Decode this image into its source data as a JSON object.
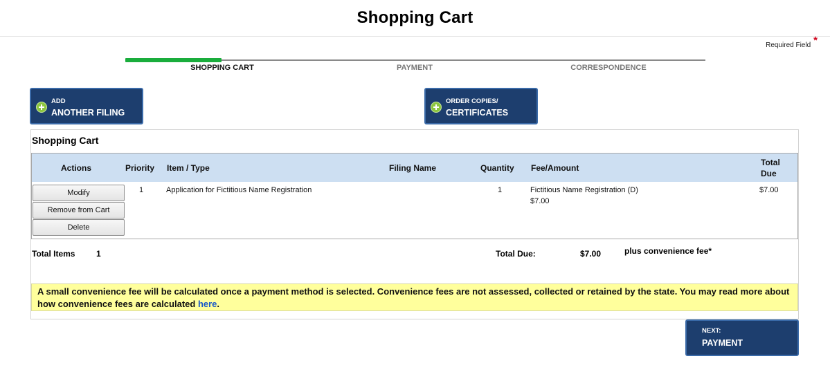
{
  "header": {
    "title": "Shopping Cart"
  },
  "required_legend": {
    "text": "Required Field",
    "mark": "*"
  },
  "progress": {
    "fraction_complete": 0.166,
    "steps": [
      {
        "label": "SHOPPING CART",
        "state": "active"
      },
      {
        "label": "PAYMENT",
        "state": "inactive"
      },
      {
        "label": "CORRESPONDENCE",
        "state": "inactive"
      }
    ]
  },
  "actions": {
    "add_filing": {
      "small": "ADD",
      "big": "ANOTHER FILING",
      "icon": "plus-circle-icon"
    },
    "order_copies": {
      "small": "ORDER COPIES/",
      "big": "CERTIFICATES",
      "icon": "plus-circle-icon"
    },
    "next": {
      "small": "NEXT:",
      "big": "PAYMENT"
    }
  },
  "cart": {
    "heading": "Shopping Cart",
    "columns": {
      "actions": "Actions",
      "priority": "Priority",
      "item_type": "Item / Type",
      "filing_name": "Filing Name",
      "quantity": "Quantity",
      "fee_amount": "Fee/Amount",
      "total_due_1": "Total",
      "total_due_2": "Due"
    },
    "rows": [
      {
        "priority": "1",
        "item_type": "Application for Fictitious Name Registration",
        "filing_name": "",
        "quantity": "1",
        "fee_name": "Fictitious Name Registration (D)",
        "fee_amount": "$7.00",
        "total_due": "$7.00",
        "buttons": {
          "modify": "Modify",
          "remove": "Remove from Cart",
          "delete": "Delete"
        }
      }
    ],
    "totals": {
      "items_label": "Total Items",
      "items_value": "1",
      "due_label": "Total Due:",
      "due_value": "$7.00",
      "fee_note": "plus convenience fee*"
    }
  },
  "notice": {
    "text": "A small convenience fee will be calculated once a payment method is selected. Convenience fees are not assessed, collected or retained by the state. You may read more about how convenience fees are calculated ",
    "link": "here",
    "end": "."
  },
  "colors": {
    "button_bg": "#1d3e6e",
    "progress_fill": "#1aad3c",
    "table_header_bg": "#cddff2",
    "notice_bg": "#ffff9c",
    "link": "#1a5ac8",
    "required_star": "#d0021b"
  }
}
